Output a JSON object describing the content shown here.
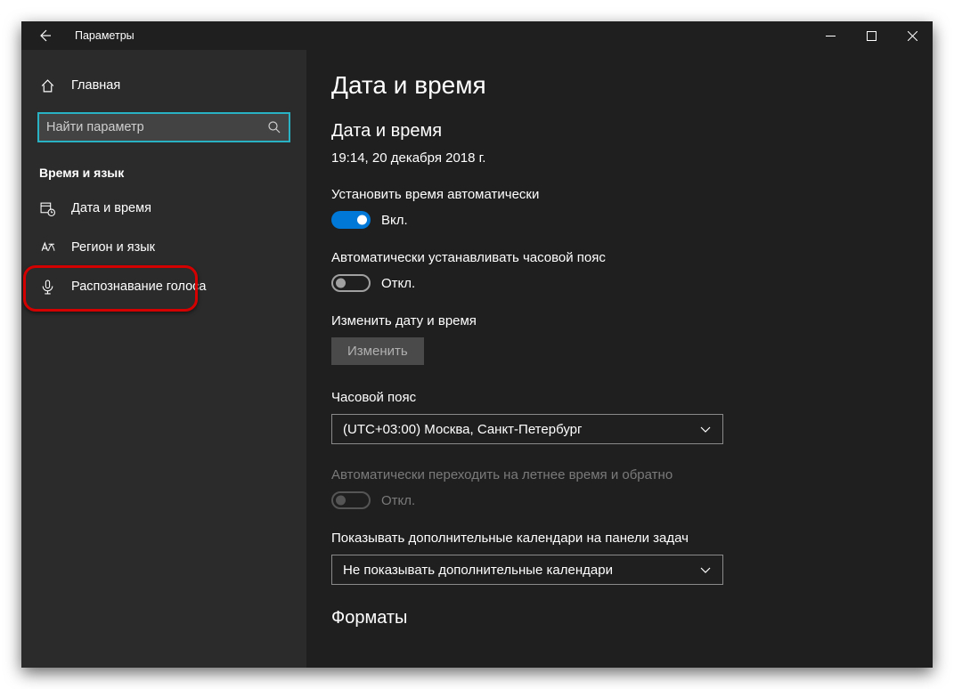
{
  "titlebar": {
    "title": "Параметры"
  },
  "sidebar": {
    "home": "Главная",
    "search_placeholder": "Найти параметр",
    "section": "Время и язык",
    "items": [
      {
        "label": "Дата и время"
      },
      {
        "label": "Регион и язык"
      },
      {
        "label": "Распознавание голоса"
      }
    ]
  },
  "content": {
    "page_title": "Дата и время",
    "subtitle": "Дата и время",
    "datetime": "19:14, 20 декабря 2018 г.",
    "auto_time_label": "Установить время автоматически",
    "auto_time_state": "Вкл.",
    "auto_tz_label": "Автоматически устанавливать часовой пояс",
    "auto_tz_state": "Откл.",
    "change_dt_label": "Изменить дату и время",
    "change_btn": "Изменить",
    "tz_label": "Часовой пояс",
    "tz_value": "(UTC+03:00) Москва, Санкт-Петербург",
    "dst_label": "Автоматически переходить на летнее время и обратно",
    "dst_state": "Откл.",
    "extra_cal_label": "Показывать дополнительные календари на панели задач",
    "extra_cal_value": "Не показывать дополнительные календари",
    "formats_title": "Форматы"
  }
}
